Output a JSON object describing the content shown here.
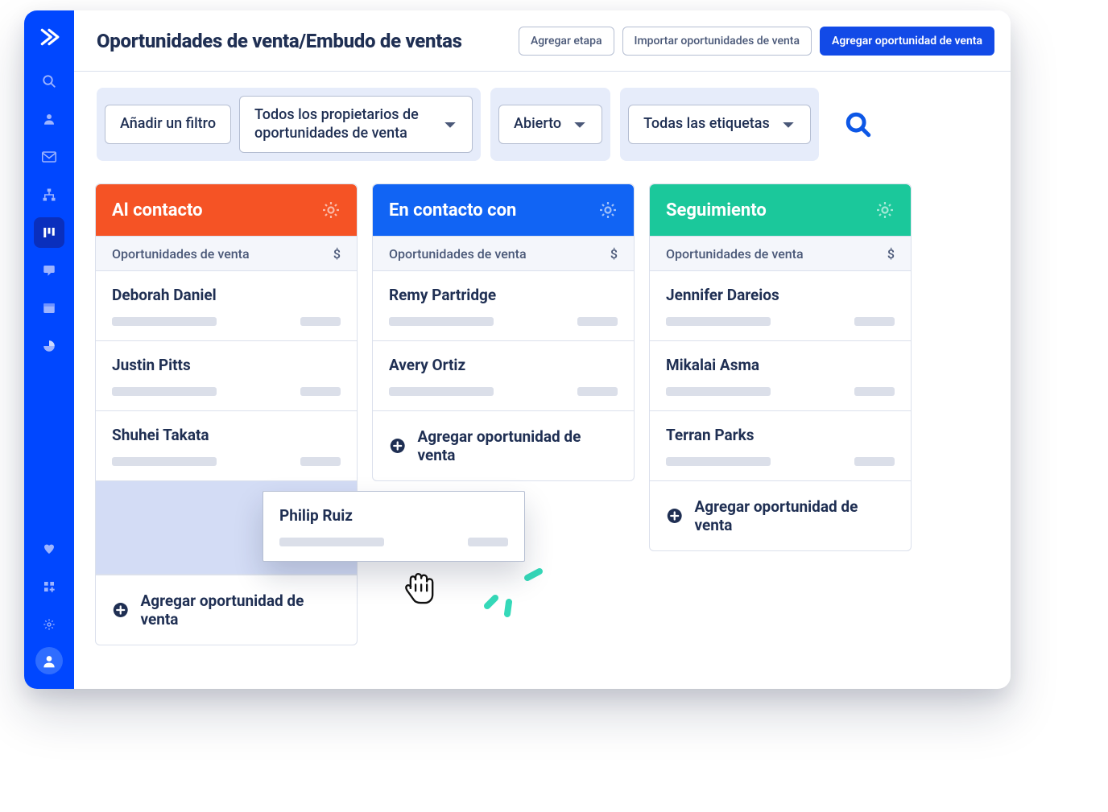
{
  "header": {
    "title": "Oportunidades de venta/Embudo de ventas",
    "btn_add_stage": "Agregar etapa",
    "btn_import": "Importar oportunidades de venta",
    "btn_add_deal": "Agregar oportunidad de venta"
  },
  "filters": {
    "add_filter": "Añadir un filtro",
    "owners": "Todos los propietarios de oportunidades de venta",
    "status": "Abierto",
    "tags": "Todas las etiquetas"
  },
  "columns": {
    "sub_label": "Oportunidades de venta",
    "currency": "$",
    "add_deal": "Agregar oportunidad de venta",
    "a": {
      "title": "Al contacto",
      "cards": [
        "Deborah Daniel",
        "Justin Pitts",
        "Shuhei Takata"
      ]
    },
    "b": {
      "title": "En contacto con",
      "cards": [
        "Remy Partridge",
        "Avery Ortiz"
      ]
    },
    "c": {
      "title": "Seguimiento",
      "cards": [
        "Jennifer Dareios",
        "Mikalai Asma",
        "Terran Parks"
      ]
    }
  },
  "dragging": {
    "name": "Philip Ruiz"
  }
}
